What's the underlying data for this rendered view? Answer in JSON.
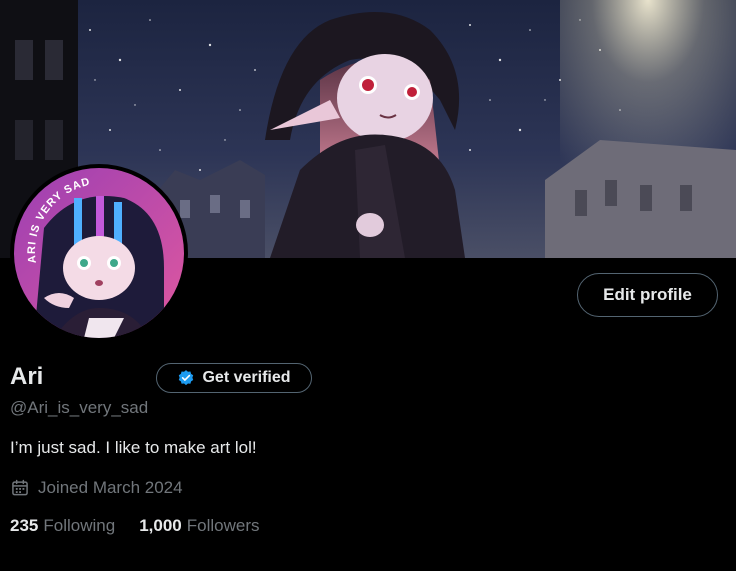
{
  "profile": {
    "name": "Ari",
    "handle": "@Ari_is_very_sad",
    "bio": "I’m just sad. I like to make art lol!",
    "joined": "Joined March 2024",
    "avatar_text": "ARI IS VERY SAD"
  },
  "actions": {
    "edit_profile": "Edit profile",
    "get_verified": "Get verified"
  },
  "stats": {
    "following_count": "235",
    "following_label": "Following",
    "followers_count": "1,000",
    "followers_label": "Followers"
  },
  "colors": {
    "background": "#000000",
    "text_primary": "#e7e9ea",
    "text_secondary": "#71767b",
    "border": "#536471",
    "verified_blue": "#1d9bf0"
  },
  "icons": {
    "verified": "verified-badge-icon",
    "calendar": "calendar-icon"
  }
}
